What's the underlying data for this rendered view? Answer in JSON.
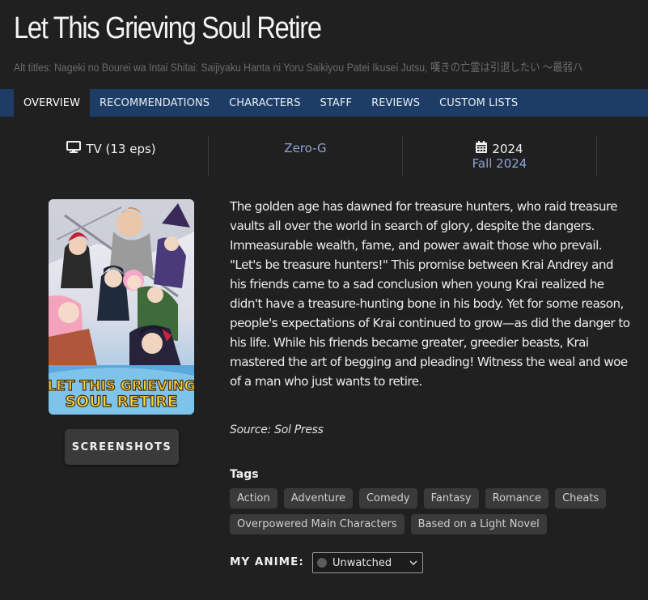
{
  "anime": {
    "title": "Let This Grieving Soul Retire",
    "alt_titles": "Alt titles: Nageki no Bourei wa Intai Shitai: Saijiyaku Hanta ni Yoru Saikiyou Patei Ikusei Jutsu, 嘆きの亡霊は引退したい 〜最弱ハ"
  },
  "nav": {
    "tabs": [
      {
        "label": "OVERVIEW"
      },
      {
        "label": "RECOMMENDATIONS"
      },
      {
        "label": "CHARACTERS"
      },
      {
        "label": "STAFF"
      },
      {
        "label": "REVIEWS"
      },
      {
        "label": "CUSTOM LISTS"
      }
    ],
    "active": "OVERVIEW"
  },
  "info": {
    "format": "TV (13 eps)",
    "format_icon": "monitor-icon",
    "studio": "Zero-G",
    "year": "2024",
    "year_icon": "calendar-icon",
    "season": "Fall 2024"
  },
  "poster": {
    "logo_line1": "LET THIS GRIEVING",
    "logo_line2": "SOUL RETIRE"
  },
  "screenshots_button": "SCREENSHOTS",
  "synopsis": "The golden age has dawned for treasure hunters, who raid treasure vaults all over the world in search of glory, despite the dangers. Immeasurable wealth, fame, and power await those who prevail. \"Let's be treasure hunters!\" This promise between Krai Andrey and his friends came to a sad conclusion when young Krai realized he didn't have a treasure-hunting bone in his body. Yet for some reason, people's expectations of Krai continued to grow—as did the danger to his life. While his friends became greater, greedier beasts, Krai mastered the art of begging and pleading! Witness the weal and woe of a man who just wants to retire.",
  "source": "Source: Sol Press",
  "tags": {
    "heading": "Tags",
    "items": [
      "Action",
      "Adventure",
      "Comedy",
      "Fantasy",
      "Romance",
      "Cheats",
      "Overpowered Main Characters",
      "Based on a Light Novel"
    ]
  },
  "my_anime": {
    "label": "MY ANIME:",
    "status": "Unwatched",
    "status_color": "#5c5c5c"
  },
  "colors": {
    "background": "#202020",
    "nav_bar": "#1e3d66",
    "link": "#8ea3d9",
    "tag_bg": "#3a3a3a"
  }
}
